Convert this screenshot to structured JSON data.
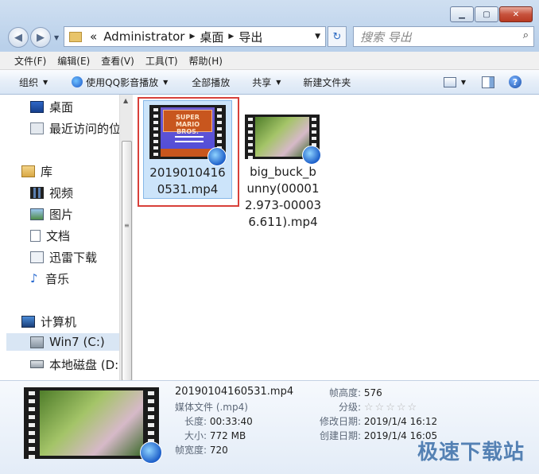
{
  "window": {
    "minimize": "▁",
    "maximize": "▢",
    "close": "✕"
  },
  "address": {
    "prefix": "«",
    "segments": [
      "Administrator",
      "桌面",
      "导出"
    ]
  },
  "search": {
    "placeholder": "搜索 导出"
  },
  "menu": [
    "文件(F)",
    "编辑(E)",
    "查看(V)",
    "工具(T)",
    "帮助(H)"
  ],
  "toolbar": {
    "organize": "组织",
    "open_with": "使用QQ影音播放",
    "play_all": "全部播放",
    "share": "共享",
    "new_folder": "新建文件夹"
  },
  "nav": {
    "items": [
      "桌面",
      "最近访问的位置",
      "库",
      "视频",
      "图片",
      "文档",
      "迅雷下载",
      "音乐",
      "计算机",
      "Win7 (C:)",
      "本地磁盘 (D:)"
    ]
  },
  "files": [
    {
      "name_line1": "2019010416",
      "name_line2": "0531.mp4",
      "thumb_text": "SUPER MARIO BROS."
    },
    {
      "name_line1": "big_buck_b",
      "name_line2": "unny(00001",
      "name_line3": "2.973-00003",
      "name_line4": "6.611).mp4"
    }
  ],
  "details": {
    "filename": "20190104160531.mp4",
    "type": "媒体文件 (.mp4)",
    "length_label": "长度:",
    "length_value": "00:33:40",
    "size_label": "大小:",
    "size_value": "772 MB",
    "width_label": "帧宽度:",
    "width_value": "720",
    "height_label": "帧高度:",
    "height_value": "576",
    "rating_label": "分级:",
    "rating": 0,
    "modified_label": "修改日期:",
    "modified_value": "2019/1/4 16:12",
    "created_label": "创建日期:",
    "created_value": "2019/1/4 16:05"
  },
  "watermark": "极速下载站"
}
